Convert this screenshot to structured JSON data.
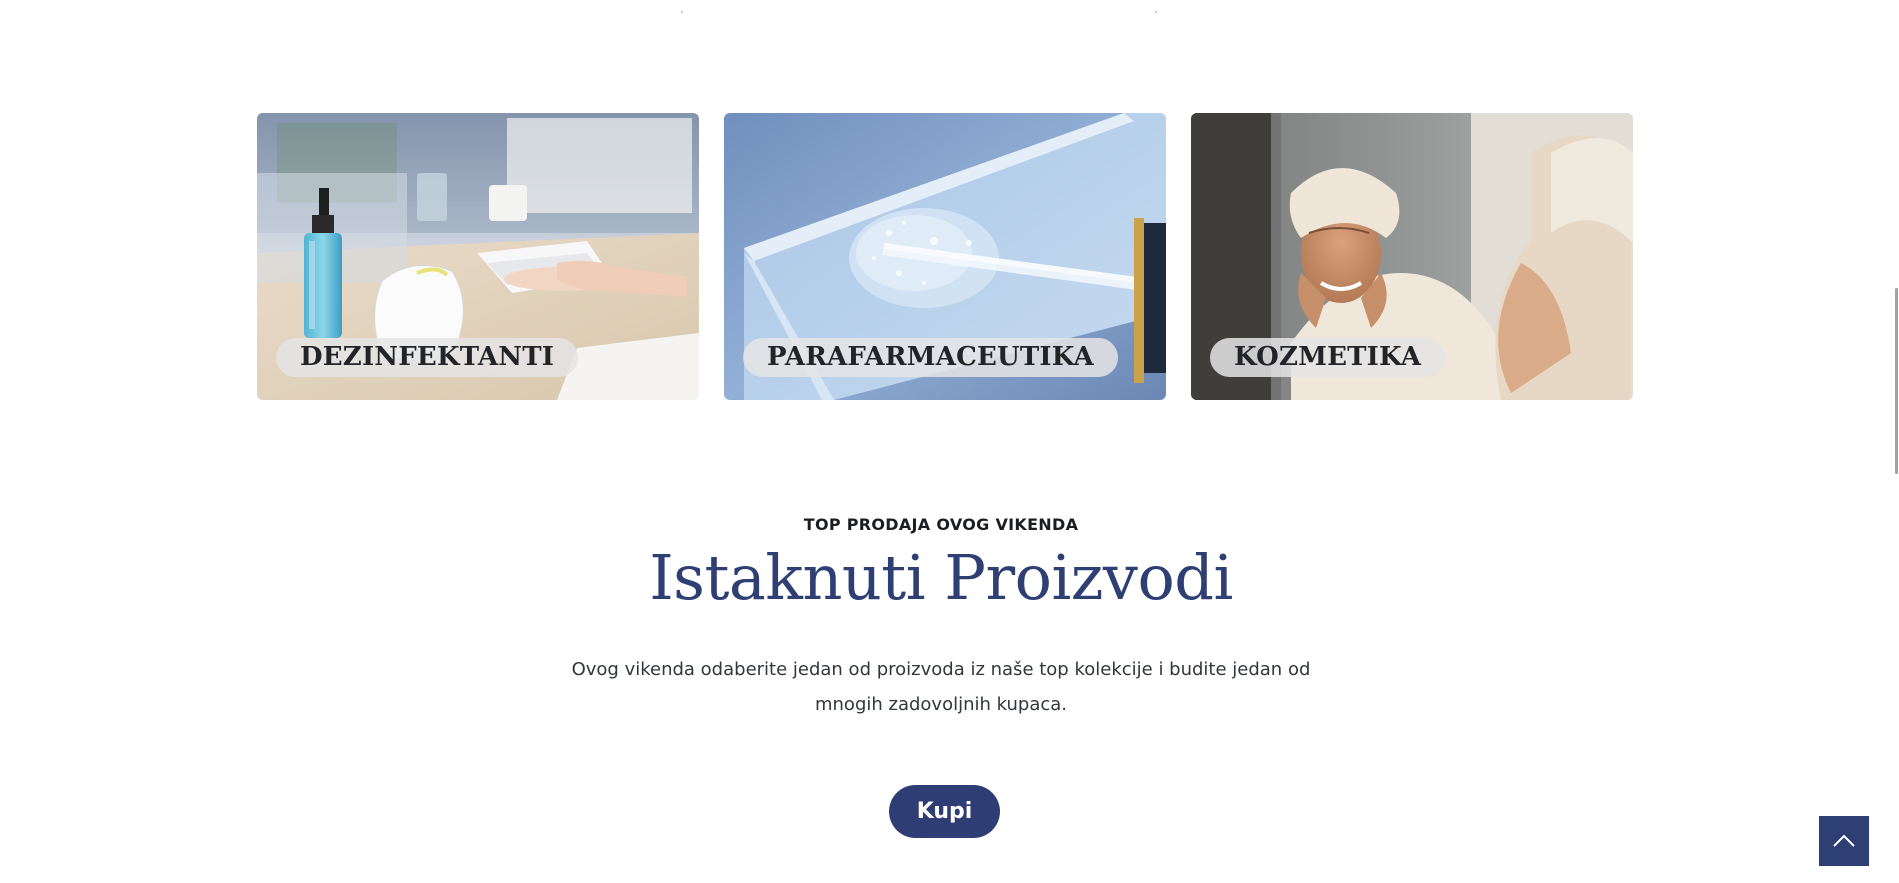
{
  "categories": [
    {
      "label": "DEZINFEKTANTI"
    },
    {
      "label": "PARAFARMACEUTIKA"
    },
    {
      "label": "KOZMETIKA"
    }
  ],
  "featured": {
    "eyebrow": "TOP PRODAJA OVOG VIKENDA",
    "title": "Istaknuti Proizvodi",
    "description": "Ovog vikenda odaberite jedan od proizvoda iz naše top kolekcije i budite jedan od mnogih zadovoljnih kupaca.",
    "button_label": "Kupi"
  },
  "colors": {
    "brand_navy": "#2d3f73",
    "label_pill": "#e4e4e4"
  },
  "icons": {
    "back_to_top": "chevron-up-icon"
  }
}
